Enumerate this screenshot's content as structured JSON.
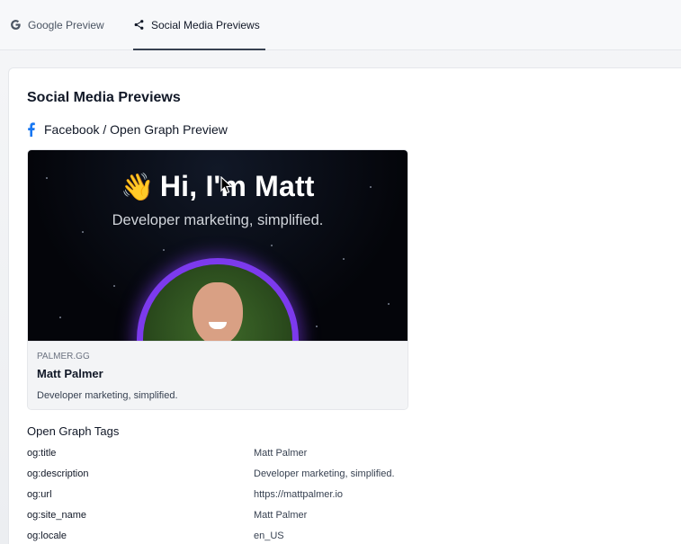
{
  "tabs": [
    {
      "label": "Google Preview",
      "icon": "google-icon",
      "active": false
    },
    {
      "label": "Social Media Previews",
      "icon": "share-icon",
      "active": true
    }
  ],
  "section": {
    "title": "Social Media Previews"
  },
  "facebook": {
    "heading": "Facebook / Open Graph Preview",
    "icon": "facebook-icon",
    "brand_color": "#1877f2"
  },
  "preview": {
    "image": {
      "headline": "Hi, I'm Matt",
      "wave_emoji": "👋",
      "subheadline": "Developer marketing, simplified.",
      "ring_color": "#7c3aed"
    },
    "domain": "PALMER.GG",
    "title": "Matt Palmer",
    "description": "Developer marketing, simplified."
  },
  "og_tags": {
    "title": "Open Graph Tags",
    "rows": [
      {
        "key": "og:title",
        "value": "Matt Palmer"
      },
      {
        "key": "og:description",
        "value": "Developer marketing, simplified."
      },
      {
        "key": "og:url",
        "value": "https://mattpalmer.io"
      },
      {
        "key": "og:site_name",
        "value": "Matt Palmer"
      },
      {
        "key": "og:locale",
        "value": "en_US"
      }
    ]
  }
}
